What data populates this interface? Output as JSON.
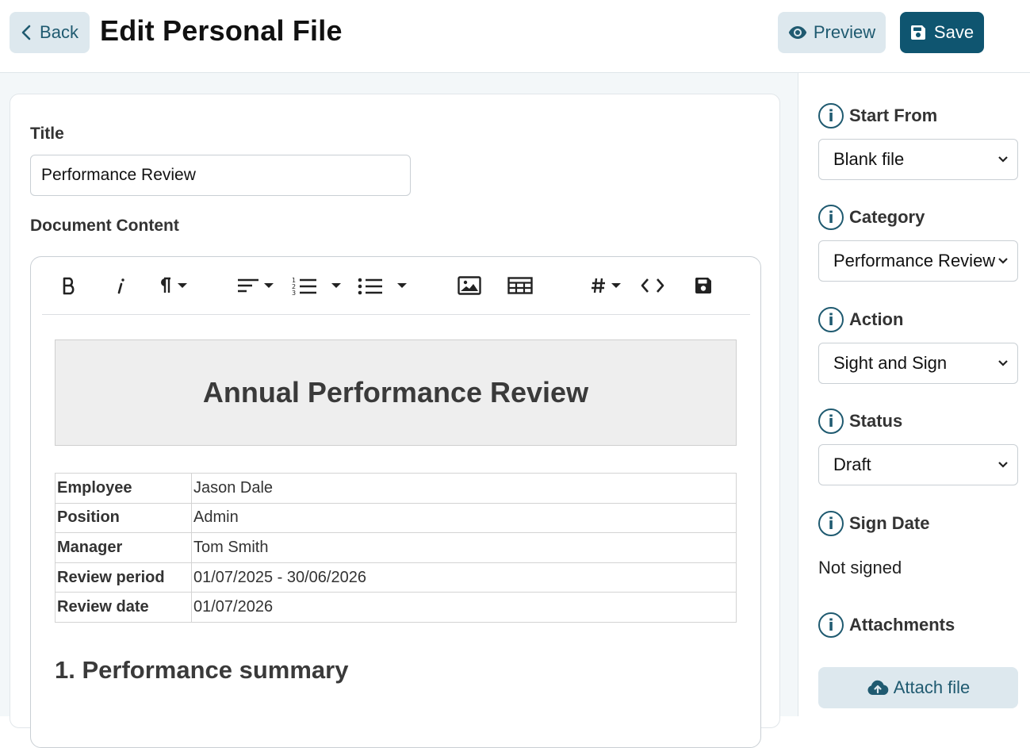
{
  "header": {
    "back_label": "Back",
    "title": "Edit Personal File",
    "preview_label": "Preview",
    "save_label": "Save"
  },
  "form": {
    "title_label": "Title",
    "title_value": "Performance Review",
    "content_label": "Document Content"
  },
  "toolbar": {
    "items": [
      "bold-icon",
      "italic-icon",
      "paragraph-icon",
      "align-icon",
      "ordered-list-icon",
      "bullet-list-icon",
      "image-icon",
      "table-icon",
      "hash-icon",
      "code-icon",
      "save-icon"
    ]
  },
  "document": {
    "heading": "Annual Performance Review",
    "rows": [
      {
        "key": "Employee",
        "value": "Jason Dale"
      },
      {
        "key": "Position",
        "value": "Admin"
      },
      {
        "key": "Manager",
        "value": "Tom Smith"
      },
      {
        "key": "Review period",
        "value": "01/07/2025 - 30/06/2026"
      },
      {
        "key": "Review date",
        "value": "01/07/2026"
      }
    ],
    "section_1": "1. Performance summary"
  },
  "sidebar": {
    "start_from": {
      "label": "Start From",
      "value": "Blank file"
    },
    "category": {
      "label": "Category",
      "value": "Performance Review"
    },
    "action": {
      "label": "Action",
      "value": "Sight and Sign"
    },
    "status": {
      "label": "Status",
      "value": "Draft"
    },
    "sign_date": {
      "label": "Sign Date",
      "value": "Not signed"
    },
    "attachments": {
      "label": "Attachments",
      "button_label": "Attach file"
    }
  },
  "colors": {
    "primary": "#0f5570",
    "secondary_bg": "#dde8ee",
    "page_bg": "#f3f7f9"
  }
}
